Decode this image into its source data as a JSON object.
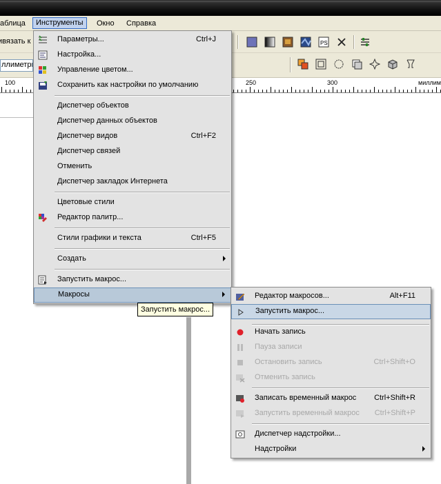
{
  "menubar": {
    "items": [
      {
        "label": "аблица"
      },
      {
        "label": "Инструменты"
      },
      {
        "label": "Окно"
      },
      {
        "label": "Справка"
      }
    ]
  },
  "toolbar1": {
    "snap_label": "ивязать к"
  },
  "toolbar2": {
    "units_value": "ллиметры"
  },
  "ruler": {
    "labels": [
      "100",
      "250",
      "300",
      "миллим"
    ]
  },
  "tools_menu": {
    "items": [
      {
        "label": "Параметры...",
        "shortcut": "Ctrl+J",
        "icon": "options-icon"
      },
      {
        "label": "Настройка...",
        "shortcut": "",
        "icon": "customize-icon"
      },
      {
        "label": "Управление цветом...",
        "shortcut": "",
        "icon": "color-management-icon"
      },
      {
        "label": "Сохранить как настройки по умолчанию",
        "shortcut": "",
        "icon": "save-defaults-icon"
      },
      {
        "label": "Диспетчер объектов",
        "shortcut": ""
      },
      {
        "label": "Диспетчер данных объектов",
        "shortcut": ""
      },
      {
        "label": "Диспетчер видов",
        "shortcut": "Ctrl+F2"
      },
      {
        "label": "Диспетчер связей",
        "shortcut": ""
      },
      {
        "label": "Отменить",
        "shortcut": ""
      },
      {
        "label": "Диспетчер закладок Интернета",
        "shortcut": ""
      },
      {
        "label": "Цветовые стили",
        "shortcut": ""
      },
      {
        "label": "Редактор палитр...",
        "shortcut": "",
        "icon": "palette-editor-icon"
      },
      {
        "label": "Стили графики и текста",
        "shortcut": "Ctrl+F5"
      },
      {
        "label": "Создать",
        "shortcut": "",
        "submenu": true
      },
      {
        "label": "Запустить макрос...",
        "shortcut": "",
        "icon": "run-macro-icon"
      },
      {
        "label": "Макросы",
        "shortcut": "",
        "submenu": true
      }
    ]
  },
  "macros_menu": {
    "items": [
      {
        "label": "Редактор макросов...",
        "shortcut": "Alt+F11",
        "icon": "macro-editor-icon"
      },
      {
        "label": "Запустить макрос...",
        "shortcut": "",
        "icon": "play-icon"
      },
      {
        "label": "Начать запись",
        "shortcut": "",
        "icon": "record-icon"
      },
      {
        "label": "Пауза записи",
        "shortcut": "",
        "icon": "pause-icon",
        "disabled": true
      },
      {
        "label": "Остановить запись",
        "shortcut": "Ctrl+Shift+O",
        "icon": "stop-icon",
        "disabled": true
      },
      {
        "label": "Отменить запись",
        "shortcut": "",
        "icon": "cancel-recording-icon",
        "disabled": true
      },
      {
        "label": "Записать временный макрос",
        "shortcut": "Ctrl+Shift+R",
        "icon": "record-temp-macro-icon"
      },
      {
        "label": "Запустить временный макрос",
        "shortcut": "Ctrl+Shift+P",
        "icon": "run-temp-macro-icon",
        "disabled": true
      },
      {
        "label": "Диспетчер надстройки...",
        "shortcut": "",
        "icon": "addon-manager-icon"
      },
      {
        "label": "Надстройки",
        "shortcut": "",
        "submenu": true
      }
    ]
  },
  "tooltip": {
    "text": "Запустить макрос..."
  },
  "colors": {
    "highlight": "#b8c9d9",
    "menu_bg": "#e3e3e3",
    "menubar_bg": "#ece9d8",
    "tooltip_bg": "#ffffe1",
    "record": "#e0202a"
  }
}
